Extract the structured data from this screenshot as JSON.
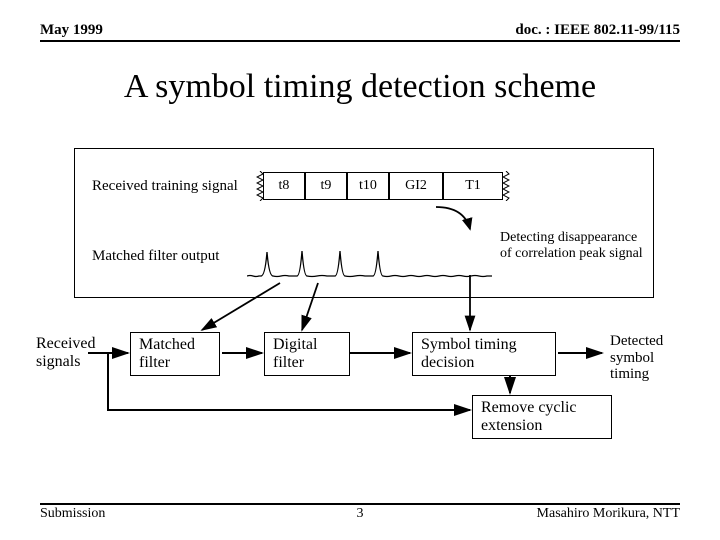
{
  "header": {
    "left": "May 1999",
    "right": "doc. : IEEE 802.11-99/115"
  },
  "title": "A symbol timing detection scheme",
  "fig": {
    "rts_label": "Received training signal",
    "mfo_label": "Matched filter output",
    "segments": {
      "t8": "t8",
      "t9": "t9",
      "t10": "t10",
      "gi2": "GI2",
      "t1": "T1"
    },
    "detect_text_l1": "Detecting disappearance",
    "detect_text_l2": "of correlation peak signal"
  },
  "flow": {
    "received_l1": "Received",
    "received_l2": "signals",
    "matched": "Matched\nfilter",
    "digital": "Digital\nfilter",
    "symbol": "Symbol timing\ndecision",
    "remove": "Remove cyclic\nextension",
    "detected_l1": "Detected",
    "detected_l2": "symbol",
    "detected_l3": "timing"
  },
  "footer": {
    "left": "Submission",
    "right": "Masahiro Morikura, NTT",
    "page": "3"
  }
}
